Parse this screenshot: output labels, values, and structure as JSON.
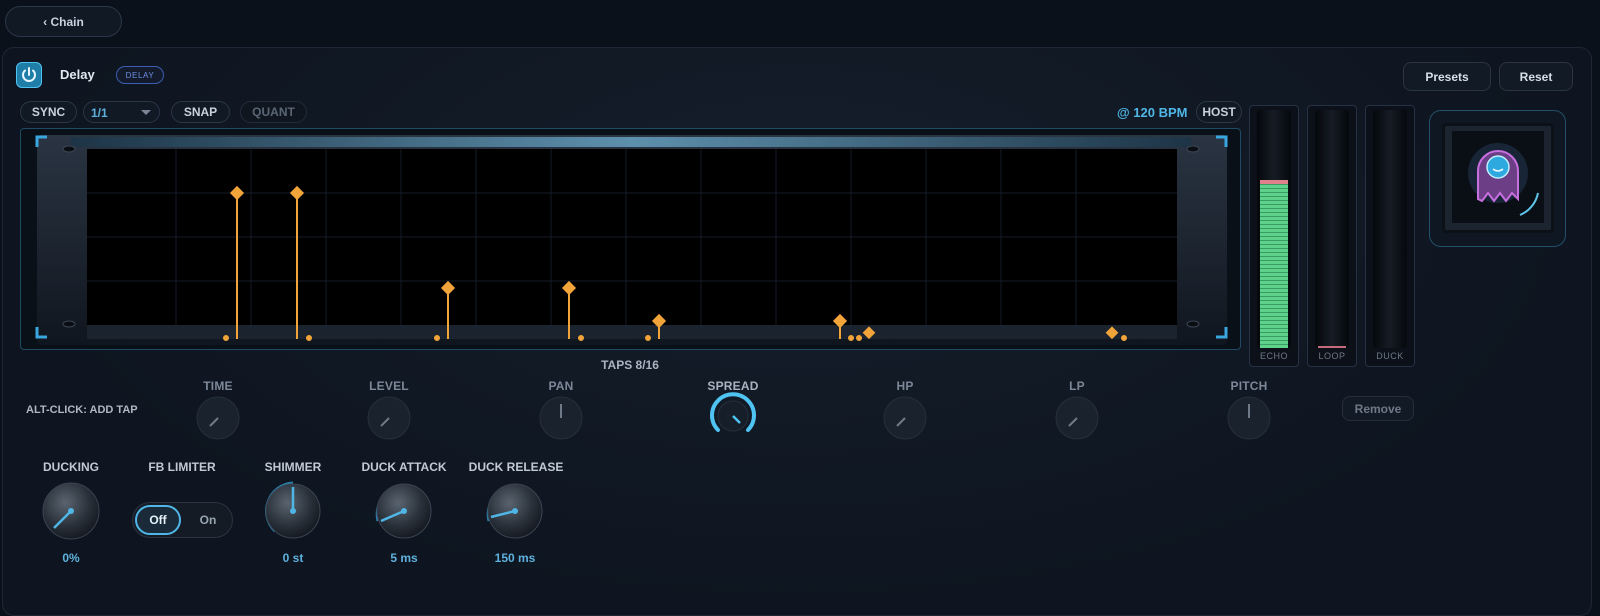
{
  "nav": {
    "back_label": "‹ Chain"
  },
  "header": {
    "power_icon": "power-icon",
    "title": "Delay",
    "badge": "DELAY",
    "presets_label": "Presets",
    "reset_label": "Reset"
  },
  "toolbar": {
    "sync_label": "SYNC",
    "division_value": "1/1",
    "snap_label": "SNAP",
    "quant_label": "QUANT",
    "bpm_text": "@ 120 BPM",
    "host_label": "HOST"
  },
  "display": {
    "taps_text": "TAPS 8/16",
    "tap_color": "#f0a43a"
  },
  "meters": [
    {
      "label": "ECHO",
      "level": 0.68,
      "peak_color": "#e0808a",
      "fill_color": "#5ed18a"
    },
    {
      "label": "LOOP",
      "level": 0.0
    },
    {
      "label": "DUCK",
      "level": 0.0
    }
  ],
  "tap_controls": {
    "hint": "ALT-CLICK: ADD TAP",
    "knobs": [
      {
        "label": "TIME"
      },
      {
        "label": "LEVEL"
      },
      {
        "label": "PAN"
      },
      {
        "label": "SPREAD"
      },
      {
        "label": "HP"
      },
      {
        "label": "LP"
      },
      {
        "label": "PITCH"
      }
    ],
    "remove_label": "Remove"
  },
  "bottom_controls": {
    "ducking": {
      "label": "DUCKING",
      "value": "0%"
    },
    "fb_limiter": {
      "label": "FB LIMITER",
      "off_label": "Off",
      "on_label": "On",
      "selected": "Off"
    },
    "shimmer": {
      "label": "SHIMMER",
      "value": "0 st"
    },
    "duck_attack": {
      "label": "DUCK ATTACK",
      "value": "5 ms"
    },
    "duck_release": {
      "label": "DUCK RELEASE",
      "value": "150 ms"
    }
  },
  "colors": {
    "accent": "#4fb6e6",
    "meter_green": "#5ed18a",
    "tap_orange": "#f0a43a"
  }
}
